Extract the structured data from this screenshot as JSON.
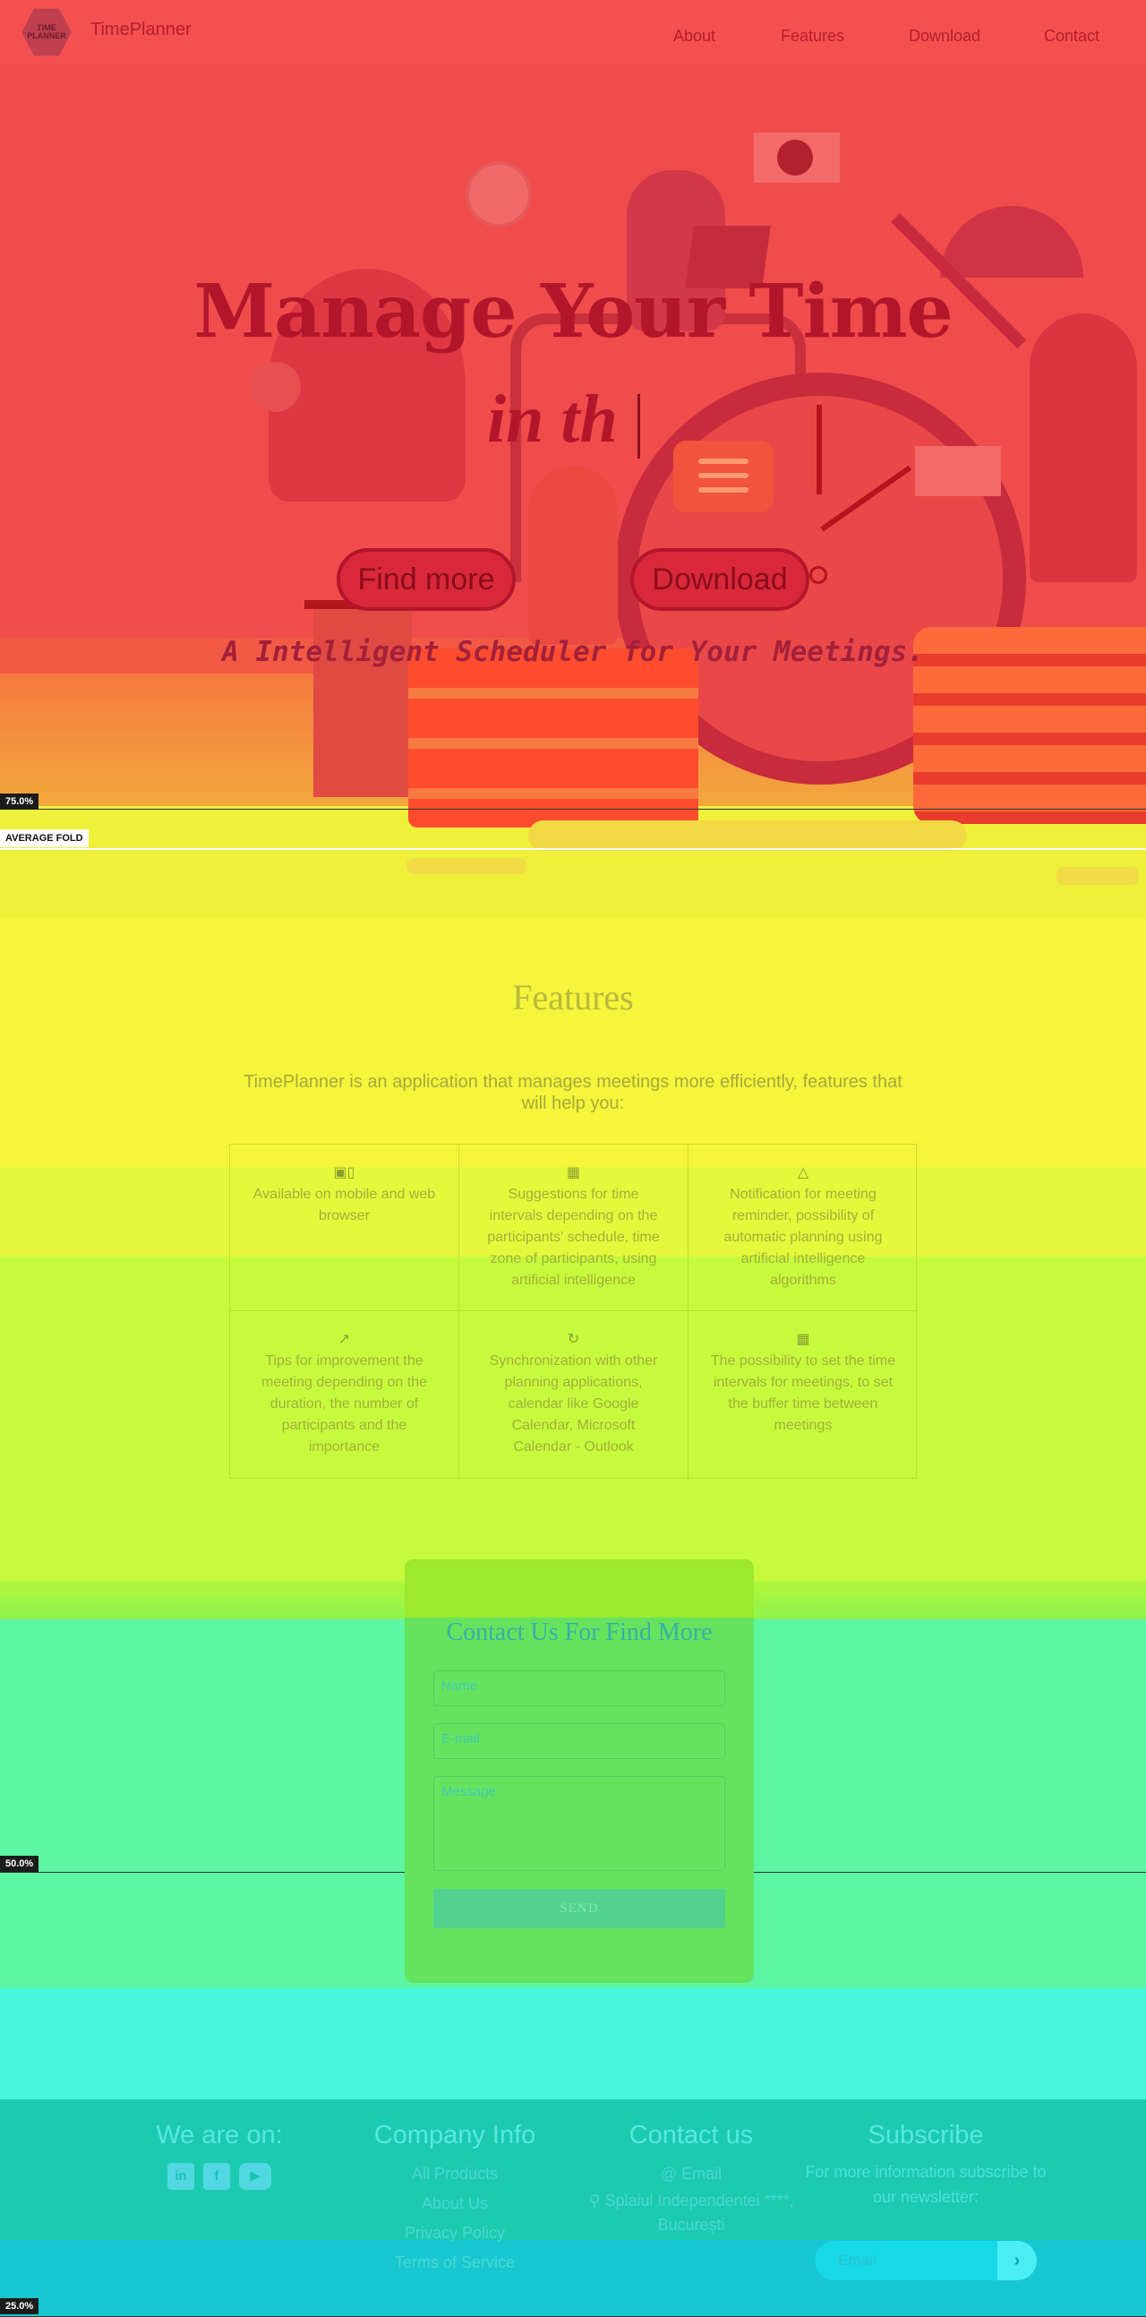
{
  "header": {
    "logo_text": "TIME PLANNER",
    "brand": "TimePlanner",
    "nav": [
      "About",
      "Features",
      "Download",
      "Contact"
    ]
  },
  "hero": {
    "title": "Manage Your Time",
    "typed": "in th",
    "buttons": [
      "Find more",
      "Download"
    ],
    "subtitle": "A Intelligent Scheduler for Your Meetings."
  },
  "heatmap": {
    "markers": [
      "75.0%",
      "50.0%",
      "25.0%"
    ],
    "fold_label": "AVERAGE FOLD",
    "colors": {
      "hot": "#f04c4c",
      "warm": "#f5f53b",
      "mid": "#c6fb3d",
      "cool": "#5cf5a3",
      "cold": "#1ccab0"
    }
  },
  "features": {
    "title": "Features",
    "description": "TimePlanner is an application that manages meetings more efficiently, features that will help you:",
    "items": [
      {
        "icon": "devices-icon",
        "text": "Available on mobile and web browser"
      },
      {
        "icon": "calendar-icon",
        "text": "Suggestions for time intervals depending on the participants' schedule, time zone of participants, using artificial intelligence"
      },
      {
        "icon": "bell-icon",
        "text": "Notification for meeting reminder, possibility of automatic planning using artificial intelligence algorithms"
      },
      {
        "icon": "chart-line-icon",
        "text": "Tips for improvement the meeting depending on the duration, the number of participants and the importance"
      },
      {
        "icon": "sync-icon",
        "text": "Synchronization with other planning applications, calendar like Google Calendar, Microsoft Calendar - Outlook"
      },
      {
        "icon": "calendar-icon",
        "text": "The possibility to set the time intervals for meetings, to set the buffer time between meetings"
      }
    ]
  },
  "contact": {
    "title": "Contact Us For Find More",
    "name_placeholder": "Name",
    "email_placeholder": "E-mail",
    "message_placeholder": "Message",
    "send": "SEND"
  },
  "footer": {
    "social_title": "We are on:",
    "social": [
      "linkedin-icon",
      "facebook-icon",
      "youtube-icon"
    ],
    "company_title": "Company Info",
    "company_links": [
      "All Products",
      "About Us",
      "Privacy Policy",
      "Terms of Service"
    ],
    "contact_title": "Contact us",
    "email": "Email",
    "address": "Splaiul Independentei ****, București",
    "subscribe_title": "Subscribe",
    "subscribe_text": "For more information subscribe to our newsletter:",
    "email_placeholder": "Email"
  }
}
